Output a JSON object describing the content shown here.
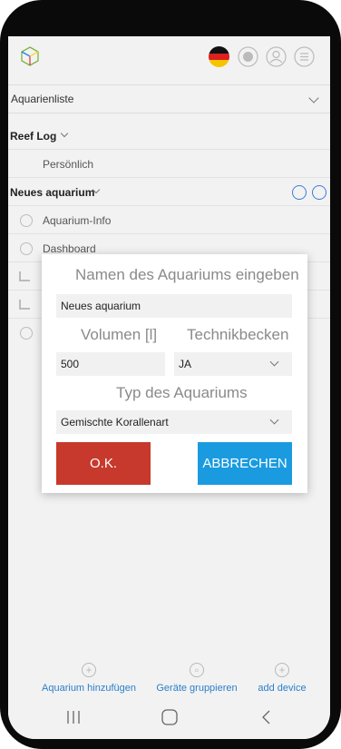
{
  "header": {
    "icons": [
      "cube-logo-icon",
      "flag-icon",
      "globe-icon",
      "user-icon",
      "menu-icon"
    ]
  },
  "aquarium_select": {
    "label": "Aquarienliste"
  },
  "tree": {
    "reef_log": "Reef Log",
    "personal": "Persönlich",
    "aquarium": "Neues aquarium",
    "items": [
      {
        "label": "Aquarium-Info"
      },
      {
        "label": "Dashboard"
      }
    ]
  },
  "modal": {
    "name_heading": "Namen des Aquariums eingeben",
    "name_value": "Neues aquarium",
    "volume_heading": "Volumen [l]",
    "sump_heading": "Technikbecken",
    "volume_value": "500",
    "sump_value": "JA",
    "type_heading": "Typ des Aquariums",
    "type_value": "Gemischte Korallenart",
    "ok_label": "O.K.",
    "cancel_label": "ABBRECHEN"
  },
  "bottom_actions": {
    "add_aquarium": "Aquarium hinzufügen",
    "group_devices": "Geräte gruppieren",
    "add_device": "add device"
  },
  "colors": {
    "ok_button": "#c6392c",
    "cancel_button": "#1a9be0",
    "link_text": "#2a7fc9"
  }
}
